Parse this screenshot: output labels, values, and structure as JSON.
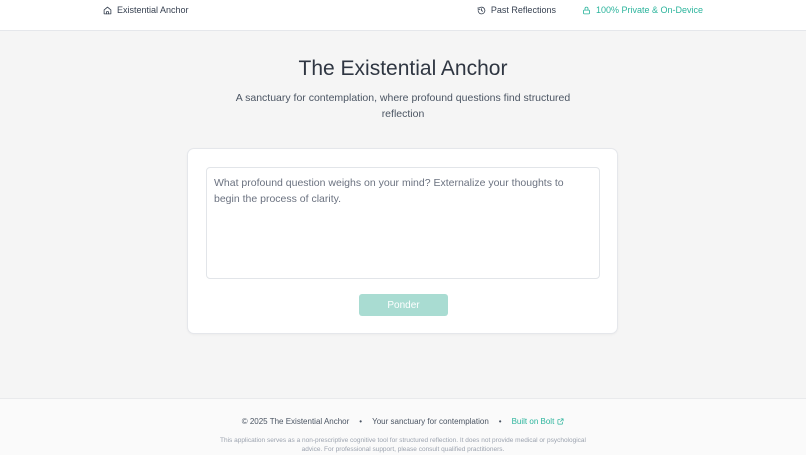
{
  "header": {
    "brand": "Existential Anchor",
    "past_reflections": "Past Reflections",
    "privacy": "100% Private & On-Device"
  },
  "hero": {
    "title": "The Existential Anchor",
    "subtitle": "A sanctuary for contemplation, where profound questions find structured reflection"
  },
  "composer": {
    "placeholder": "What profound question weighs on your mind? Externalize your thoughts to begin the process of clarity.",
    "value": "",
    "button": "Ponder"
  },
  "footer": {
    "copyright": "© 2025 The Existential Anchor",
    "separator": "•",
    "tagline": "Your sanctuary for contemplation",
    "built_on": "Built on Bolt",
    "disclaimer": "This application serves as a non-prescriptive cognitive tool for structured reflection. It does not provide medical or psychological advice. For professional support, please consult qualified practitioners."
  },
  "colors": {
    "accent": "#2bb49c",
    "button_disabled": "#a9dcd2",
    "background": "#f5f5f5"
  },
  "icons": {
    "brand": "home-icon",
    "past_reflections": "history-icon",
    "privacy": "lock-icon",
    "built_on": "external-link-icon"
  }
}
